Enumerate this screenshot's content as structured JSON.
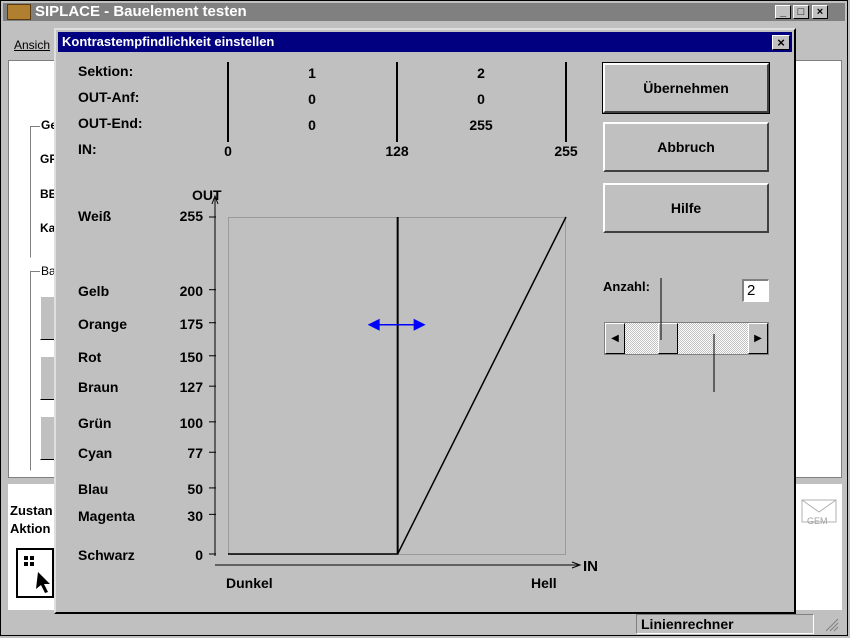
{
  "main_window": {
    "title": "SIPLACE - Bauelement testen",
    "menu_first": "Ansich",
    "peek_group1_label": "Ge",
    "peek_row_labels": [
      "GF",
      "BE",
      "Ka"
    ],
    "peek_group2_label": "Ba",
    "peek_status_label": "Zustan",
    "peek_action_label": "Aktion",
    "gem_label": "GEM",
    "status_text": "Linienrechner"
  },
  "dialog": {
    "title": "Kontrastempfindlichkeit einstellen",
    "close_glyph": "×",
    "table": {
      "row_labels": [
        "Sektion:",
        "OUT-Anf:",
        "OUT-End:",
        "IN:"
      ],
      "section_values": [
        "1",
        "2"
      ],
      "out_start_values": [
        "0",
        "0"
      ],
      "out_end_values": [
        "0",
        "255"
      ],
      "in_values": [
        "0",
        "128",
        "255"
      ]
    },
    "buttons": {
      "apply": "Übernehmen",
      "cancel": "Abbruch",
      "help": "Hilfe"
    },
    "count_label": "Anzahl:",
    "count_value": "2",
    "slider_level": 0.33
  },
  "chart_data": {
    "type": "line",
    "ylabel": "OUT",
    "xlabel": "IN",
    "x_min_label": "Dunkel",
    "x_max_label": "Hell",
    "xlim": [
      0,
      255
    ],
    "ylim": [
      0,
      255
    ],
    "y_ticks": [
      {
        "name": "Weiß",
        "value": 255
      },
      {
        "name": "Gelb",
        "value": 200
      },
      {
        "name": "Orange",
        "value": 175
      },
      {
        "name": "Rot",
        "value": 150
      },
      {
        "name": "Braun",
        "value": 127
      },
      {
        "name": "Grün",
        "value": 100
      },
      {
        "name": "Cyan",
        "value": 77
      },
      {
        "name": "Blau",
        "value": 50
      },
      {
        "name": "Magenta",
        "value": 30
      },
      {
        "name": "Schwarz",
        "value": 0
      }
    ],
    "section_boundary_in": 128,
    "curve": [
      {
        "x": 0,
        "y": 0
      },
      {
        "x": 128,
        "y": 0
      },
      {
        "x": 255,
        "y": 255
      }
    ],
    "colors": {
      "curve": "#000000",
      "drag_arrow": "#0000ff"
    }
  }
}
